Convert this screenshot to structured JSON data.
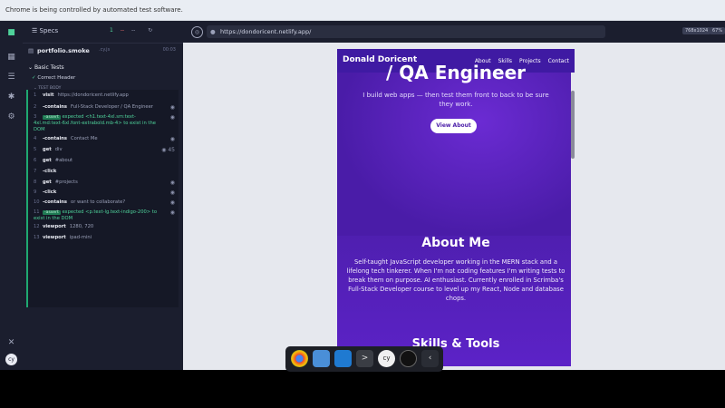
{
  "infobar": {
    "text": "Chrome is being controlled by automated test software."
  },
  "runner": {
    "specs_label": "Specs",
    "stats": {
      "passed": "1",
      "failed": "--",
      "pending": "--"
    },
    "file": {
      "name": "portfolio.smoke",
      "ext": ".cy.js",
      "time": "00:03"
    },
    "suite": {
      "title": "Basic Tests",
      "test": "Correct Header",
      "body_label": "TEST BODY"
    },
    "steps": [
      {
        "n": "1",
        "cmd": "visit",
        "arg": "https://dondoricent.netlify.app"
      },
      {
        "n": "2",
        "cmd": "-contains",
        "arg": "Full-Stack Developer / QA Engineer"
      },
      {
        "n": "3",
        "cmd": "-assert",
        "arg": "expected <h1.text-4xl.sm:text-4xl.md:text-6xl.font-extrabold.mb-4> to exist in the DOM"
      },
      {
        "n": "4",
        "cmd": "-contains",
        "arg": "Contact Me"
      },
      {
        "n": "5",
        "cmd": "get",
        "arg": "div"
      },
      {
        "n": "6",
        "cmd": "get",
        "arg": "#about"
      },
      {
        "n": "7",
        "cmd": "-click",
        "arg": ""
      },
      {
        "n": "8",
        "cmd": "get",
        "arg": "#projects"
      },
      {
        "n": "9",
        "cmd": "-click",
        "arg": ""
      },
      {
        "n": "10",
        "cmd": "-contains",
        "arg": "or want to collaborate?"
      },
      {
        "n": "11",
        "cmd": "-assert",
        "arg": "expected <p.text-lg.text-indigo-200> to exist in the DOM"
      },
      {
        "n": "12",
        "cmd": "viewport",
        "arg": "1280, 720"
      },
      {
        "n": "13",
        "cmd": "viewport",
        "arg": "ipad-mini"
      }
    ],
    "step5_count": "45"
  },
  "preview": {
    "url": "https://dondoricent.netlify.app/",
    "size": "768x1024",
    "zoom": "67%",
    "site": {
      "brand": "Donald Doricent",
      "nav": [
        "About",
        "Skills",
        "Projects",
        "Contact"
      ],
      "hero_title": "/ QA Engineer",
      "hero_sub": "I build web apps — then test them front to back to be sure they work.",
      "hero_btn": "View About",
      "about_title": "About Me",
      "about_text": "Self-taught JavaScript developer working in the MERN stack and a lifelong tech tinkerer. When I'm not coding features I'm writing tests to break them on purpose. AI enthusiast. Currently enrolled in Scrimba's Full-Stack Developer course to level up my React, Node and database chops.",
      "skills_title": "Skills & Tools"
    }
  },
  "colors": {
    "accent": "#1fa971",
    "purple": "#5a20bf"
  }
}
